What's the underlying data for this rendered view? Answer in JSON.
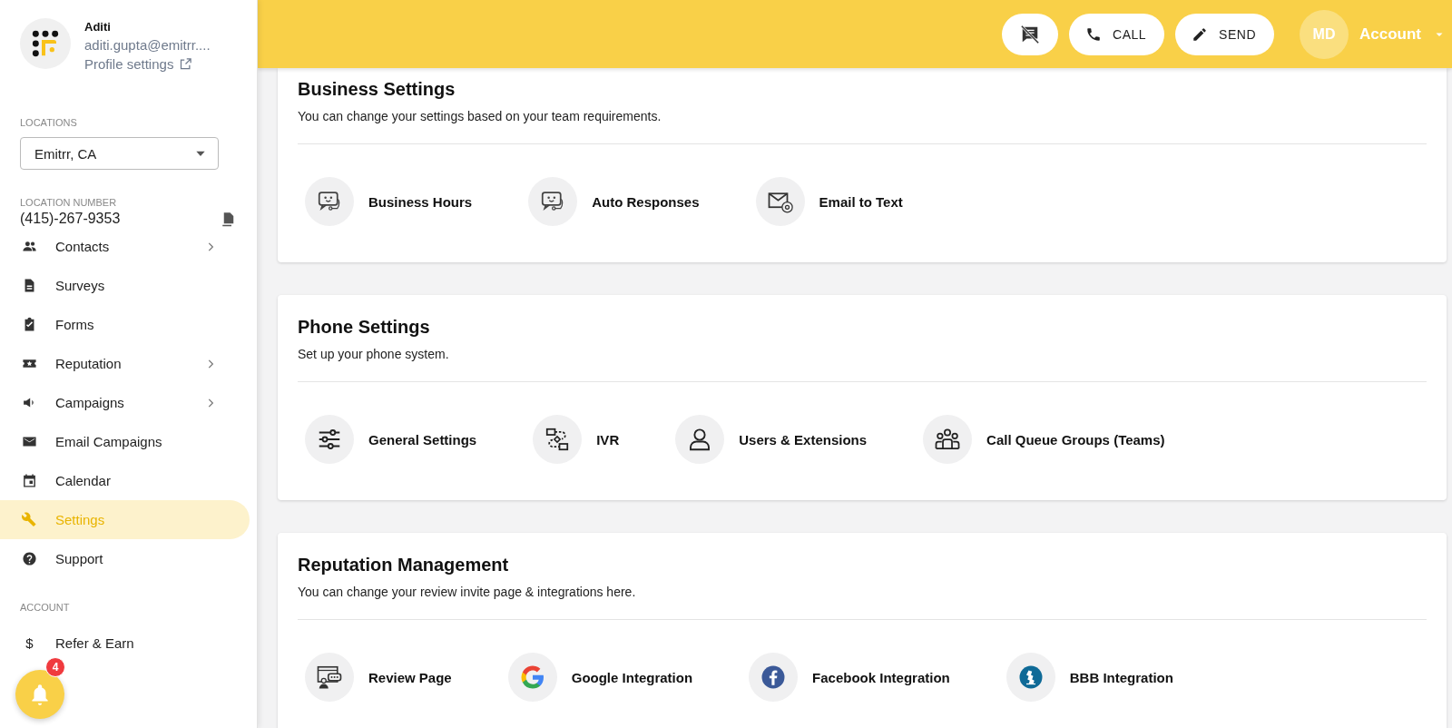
{
  "profile": {
    "name": "Aditi",
    "email": "aditi.gupta@emitrr....",
    "settings_link": "Profile settings"
  },
  "locations": {
    "label": "LOCATIONS",
    "value": "Emitrr, CA"
  },
  "location_number": {
    "label": "LOCATION NUMBER",
    "value": "(415)-267-9353"
  },
  "sidebar": {
    "items": [
      {
        "label": "Contacts",
        "expandable": true,
        "selected": false
      },
      {
        "label": "Surveys",
        "expandable": false,
        "selected": false
      },
      {
        "label": "Forms",
        "expandable": false,
        "selected": false
      },
      {
        "label": "Reputation",
        "expandable": true,
        "selected": false
      },
      {
        "label": "Campaigns",
        "expandable": true,
        "selected": false
      },
      {
        "label": "Email Campaigns",
        "expandable": false,
        "selected": false
      },
      {
        "label": "Calendar",
        "expandable": false,
        "selected": false
      },
      {
        "label": "Settings",
        "expandable": false,
        "selected": true
      },
      {
        "label": "Support",
        "expandable": false,
        "selected": false
      }
    ],
    "account_heading": "ACCOUNT",
    "account_items": [
      {
        "label": "Refer & Earn",
        "icon": "$",
        "selected": false
      }
    ]
  },
  "notifications": {
    "count": "4"
  },
  "topbar": {
    "call": "CALL",
    "send": "SEND",
    "avatar": "MD",
    "account": "Account"
  },
  "sections": [
    {
      "title": "Business Settings",
      "subtitle": "You can change your settings based on your team requirements.",
      "items": [
        {
          "label": "Business Hours",
          "kind": "chatbot"
        },
        {
          "label": "Auto Responses",
          "kind": "chatbot"
        },
        {
          "label": "Email to Text",
          "kind": "email"
        }
      ]
    },
    {
      "title": "Phone Settings",
      "subtitle": "Set up your phone system.",
      "items": [
        {
          "label": "General Settings",
          "kind": "sliders"
        },
        {
          "label": "IVR",
          "kind": "flow"
        },
        {
          "label": "Users & Extensions",
          "kind": "user"
        },
        {
          "label": "Call Queue Groups (Teams)",
          "kind": "team"
        }
      ]
    },
    {
      "title": "Reputation Management",
      "subtitle": "You can change your review invite page & integrations here.",
      "items": [
        {
          "label": "Review Page",
          "kind": "review"
        },
        {
          "label": "Google Integration",
          "kind": "google"
        },
        {
          "label": "Facebook Integration",
          "kind": "facebook"
        },
        {
          "label": "BBB Integration",
          "kind": "bbb"
        }
      ]
    }
  ]
}
